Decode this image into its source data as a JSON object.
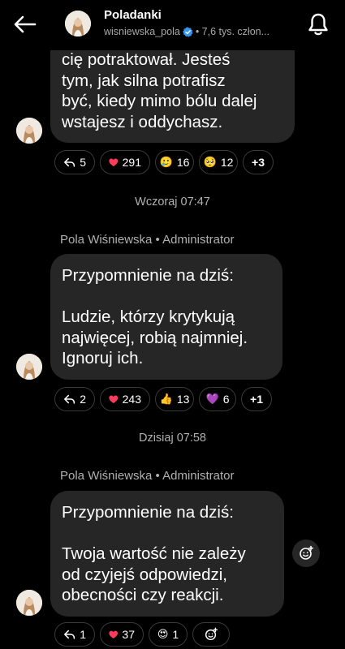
{
  "header": {
    "title": "Poladanki",
    "username": "wisniewska_pola",
    "members": "• 7,6 tys. człon..."
  },
  "messages": [
    {
      "text": "cię potraktował. Jesteś\ntym, jak silna potrafisz\nbyć, kiedy mimo bólu dalej\nwstajesz i oddychasz.",
      "reactions": {
        "replies": "5",
        "heart": "291",
        "r2": "16",
        "r2_emoji": "🥲",
        "r3": "12",
        "r3_emoji": "🥺",
        "more": "+3"
      }
    },
    {
      "date": "Wczoraj 07:47",
      "sender": "Pola Wiśniewska • Administrator",
      "text": "Przypomnienie na dziś:\n\nLudzie, którzy krytykują\nnajwięcej, robią najmniej.\nIgnoruj ich.",
      "reactions": {
        "replies": "2",
        "heart": "243",
        "r2": "13",
        "r2_emoji": "👍",
        "r3": "6",
        "r3_emoji": "💜",
        "more": "+1"
      }
    },
    {
      "date": "Dzisiaj 07:58",
      "sender": "Pola Wiśniewska • Administrator",
      "text": "Przypomnienie na dziś:\n\nTwoja wartość nie zależy\nod czyjejś odpowiedzi,\nobecności czy reakcji.",
      "reactions": {
        "replies": "1",
        "heart": "37",
        "r2": "1",
        "r2_emoji": "😍"
      }
    }
  ],
  "colors": {
    "background": "#000000",
    "bubble": "#262626",
    "secondary_text": "#a8a8a8",
    "heart": "#ff3b5c",
    "verified": "#3797f0"
  }
}
